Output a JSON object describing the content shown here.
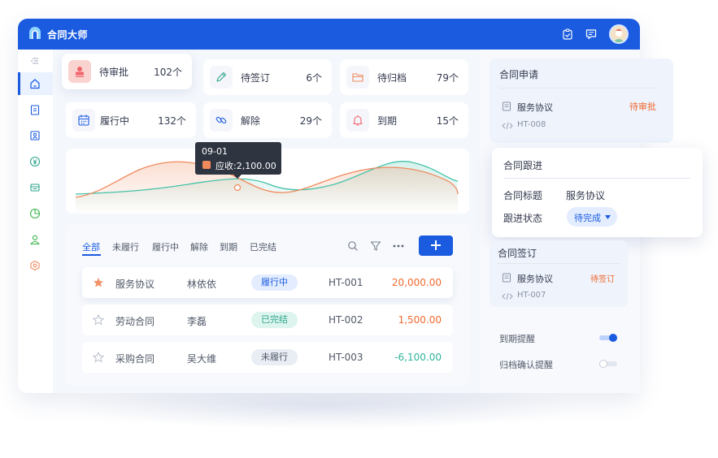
{
  "app": {
    "title": "合同大师"
  },
  "stats": [
    {
      "label": "待审批",
      "count": "102个"
    },
    {
      "label": "待签订",
      "count": "6个"
    },
    {
      "label": "待归档",
      "count": "79个"
    },
    {
      "label": "履行中",
      "count": "132个"
    },
    {
      "label": "解除",
      "count": "29个"
    },
    {
      "label": "到期",
      "count": "15个"
    }
  ],
  "chart_data": {
    "type": "area",
    "series": [
      {
        "color": "#f08a5d"
      },
      {
        "color": "#46c2a9"
      }
    ],
    "tooltip": {
      "date": "09-01",
      "text": "应收:2,100.00"
    }
  },
  "tabs": [
    "全部",
    "未履行",
    "履行中",
    "解除",
    "到期",
    "已完结"
  ],
  "table": {
    "rows": [
      {
        "name": "服务协议",
        "person": "林依依",
        "status": "履行中",
        "code": "HT-001",
        "amount": "20,000.00",
        "starred": true
      },
      {
        "name": "劳动合同",
        "person": "李磊",
        "status": "已完结",
        "code": "HT-002",
        "amount": "1,500.00",
        "starred": false
      },
      {
        "name": "采购合同",
        "person": "吴大维",
        "status": "未履行",
        "code": "HT-003",
        "amount": "-6,100.00",
        "starred": false
      }
    ]
  },
  "right": {
    "apply": {
      "title": "合同申请",
      "doc": "服务协议",
      "status": "待审批",
      "code": "HT-008"
    },
    "follow": {
      "title": "合同跟进",
      "k1": "合同标题",
      "v1": "服务协议",
      "k2": "跟进状态",
      "v2": "待完成"
    },
    "sign": {
      "title": "合同签订",
      "doc": "服务协议",
      "status": "待签订",
      "code": "HT-007"
    },
    "settings": [
      {
        "label": "到期提醒",
        "on": true
      },
      {
        "label": "归档确认提醒",
        "on": false
      }
    ]
  },
  "colors": {
    "brand": "#1a5be0",
    "orange": "#f08a5d",
    "green": "#46c2a9",
    "red": "#f0656c"
  }
}
